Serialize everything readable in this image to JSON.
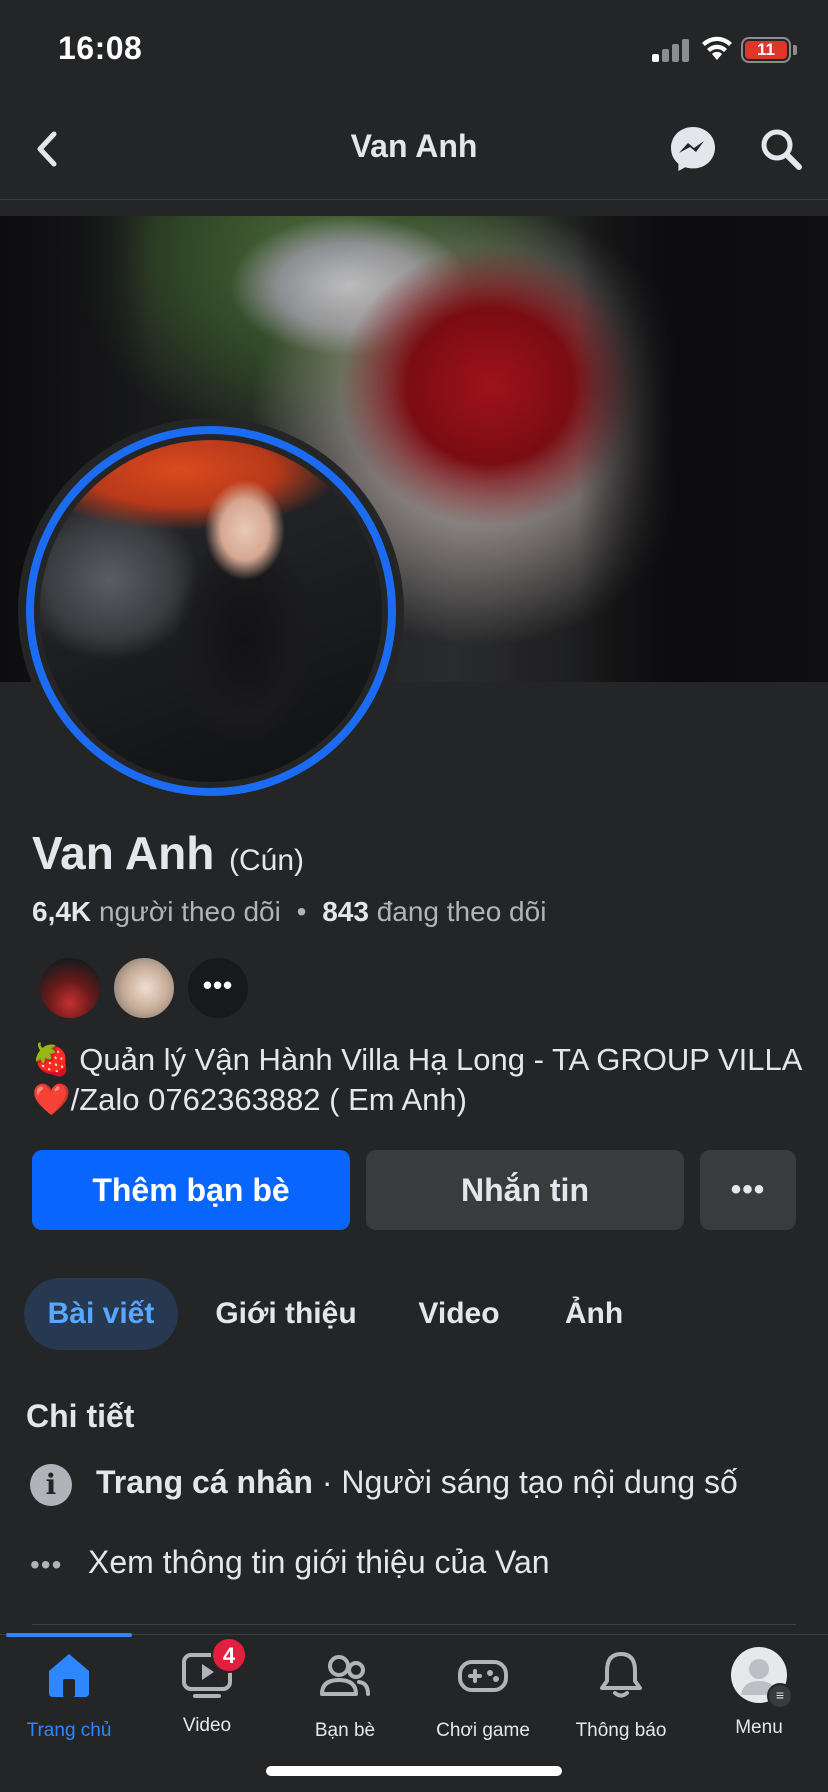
{
  "status_bar": {
    "time": "16:08",
    "battery": "11"
  },
  "header": {
    "title": "Van Anh"
  },
  "profile": {
    "name": "Van Anh",
    "alternate_name": "(Cún)",
    "followers_count": "6,4K",
    "followers_label": "người theo dõi",
    "following_count": "843",
    "following_label": "đang theo dõi",
    "separator": "•",
    "more_friends": "•••",
    "bio_emoji": "🍓",
    "bio_part1": "Quản lý Vận Hành Villa Hạ Long - TA GROUP VILLA",
    "bio_heart": "❤️",
    "bio_part2": "/Zalo 0762363882 ( Em Anh)"
  },
  "actions": {
    "add_friend": "Thêm bạn bè",
    "message": "Nhắn tin",
    "more": "•••"
  },
  "tabs": [
    {
      "label": "Bài viết",
      "active": true
    },
    {
      "label": "Giới thiệu",
      "active": false
    },
    {
      "label": "Video",
      "active": false
    },
    {
      "label": "Ảnh",
      "active": false
    }
  ],
  "details": {
    "title": "Chi tiết",
    "page_type": "Trang cá nhân",
    "page_category": " · Người sáng tạo nội dung số",
    "info_glyph": "i",
    "dots_glyph": "•••",
    "see_about": "Xem thông tin giới thiệu của Van"
  },
  "bottom_nav": [
    {
      "label": "Trang chủ",
      "icon": "home-icon",
      "active": true
    },
    {
      "label": "Video",
      "icon": "video-icon",
      "badge": "4"
    },
    {
      "label": "Bạn bè",
      "icon": "friends-icon"
    },
    {
      "label": "Chơi game",
      "icon": "gaming-icon"
    },
    {
      "label": "Thông báo",
      "icon": "bell-icon"
    },
    {
      "label": "Menu",
      "icon": "menu-avatar-icon",
      "menu_glyph": "≡"
    }
  ],
  "colors": {
    "accent": "#0866FF",
    "background": "#242526",
    "tab_active_bg": "#263951",
    "badge": "#E41E3F"
  }
}
